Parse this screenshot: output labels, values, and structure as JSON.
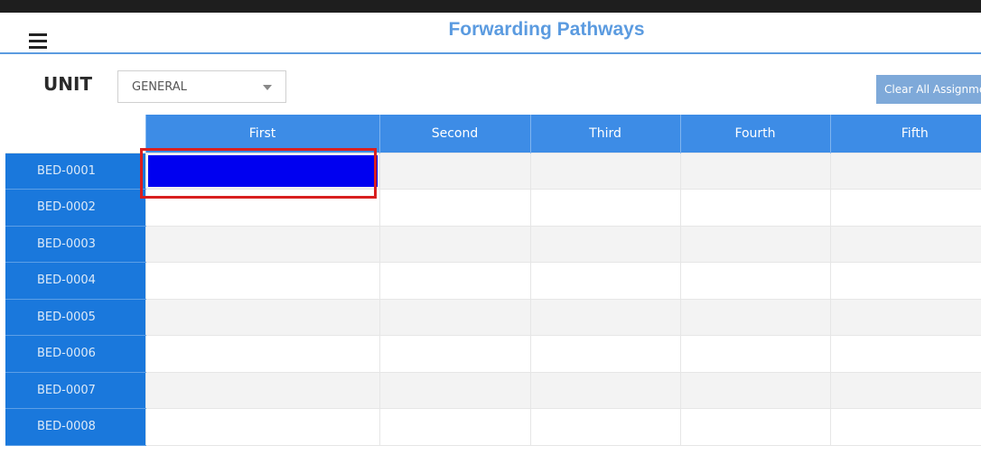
{
  "header": {
    "title": "Forwarding Pathways"
  },
  "unit": {
    "label": "UNIT",
    "selected": "GENERAL"
  },
  "actions": {
    "clear_label": "Clear All Assignments"
  },
  "grid": {
    "columns": [
      "First",
      "Second",
      "Third",
      "Fourth",
      "Fifth"
    ],
    "rows": [
      "BED-0001",
      "BED-0002",
      "BED-0003",
      "BED-0004",
      "BED-0005",
      "BED-0006",
      "BED-0007",
      "BED-0008"
    ],
    "selected_cell": {
      "row": "BED-0001",
      "column": "First"
    }
  },
  "colors": {
    "title": "#5b9be0",
    "header_bg": "#3d8ce6",
    "row_header_bg": "#1a78dc",
    "selected_fill": "#0000f0",
    "highlight_outline": "#d81f1f",
    "clear_button_bg": "#7ea9d9"
  }
}
